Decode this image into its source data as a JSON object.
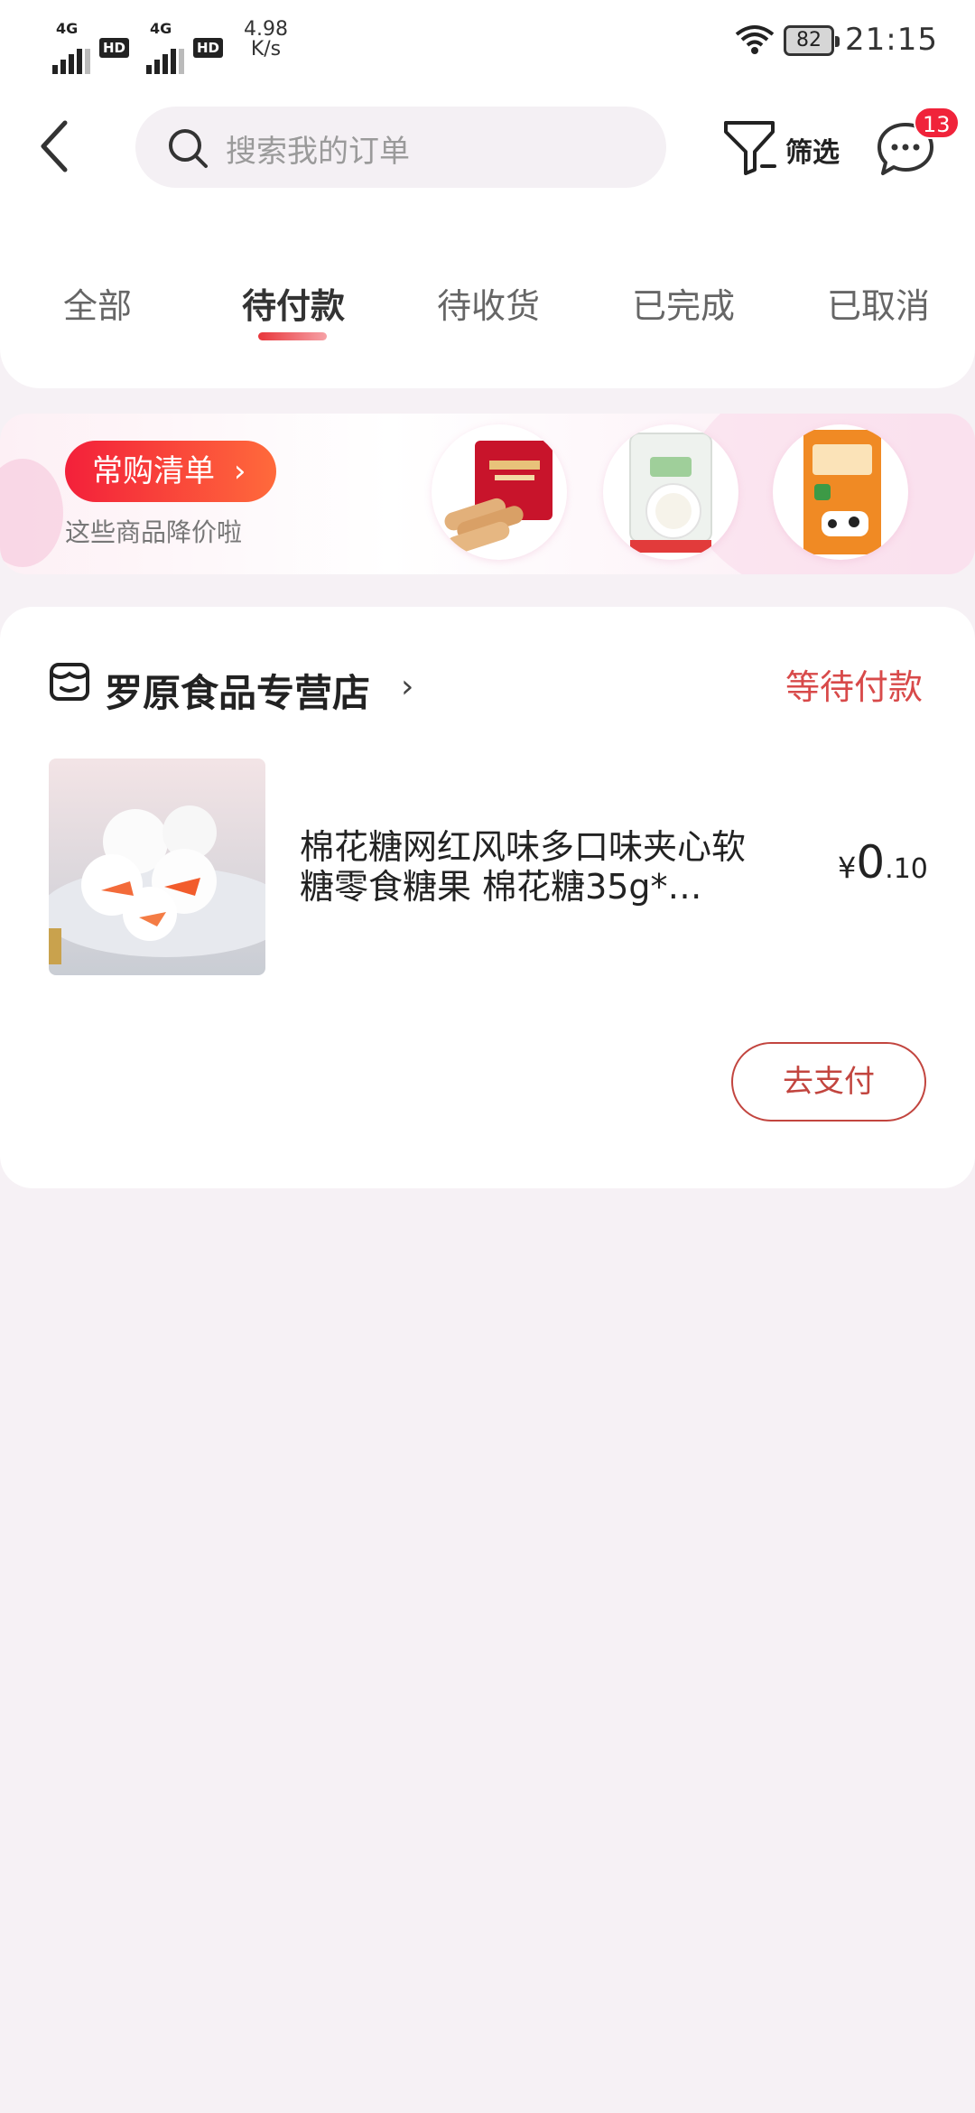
{
  "status_bar": {
    "network_1": "4G",
    "network_2": "4G",
    "hd_1": "HD",
    "hd_2": "HD",
    "speed_value": "4.98",
    "speed_unit": "K/s",
    "battery": "82",
    "time": "21:15"
  },
  "header": {
    "search_placeholder": "搜索我的订单",
    "filter_label": "筛选",
    "message_badge": "13"
  },
  "tabs": [
    {
      "label": "全部"
    },
    {
      "label": "待付款"
    },
    {
      "label": "待收货"
    },
    {
      "label": "已完成"
    },
    {
      "label": "已取消"
    }
  ],
  "active_tab": "待付款",
  "promo": {
    "button_label": "常购清单",
    "button_arrow": "›",
    "subtitle": "这些商品降价啦"
  },
  "order": {
    "shop_name": "罗原食品专营店",
    "shop_arrow": "›",
    "status": "等待付款",
    "product_title": "棉花糖网红风味多口味夹心软糖零食糖果 棉花糖35g*…",
    "price_currency": "¥",
    "price_integer": "0",
    "price_decimal": ".10",
    "pay_button": "去支付"
  },
  "colors": {
    "accent": "#e8363b",
    "status_text": "#d84a4a",
    "badge": "#f0233a",
    "background": "#f6f1f5"
  },
  "icons": [
    "back-arrow-icon",
    "search-icon",
    "filter-icon",
    "message-icon",
    "shop-icon",
    "wifi-icon"
  ]
}
